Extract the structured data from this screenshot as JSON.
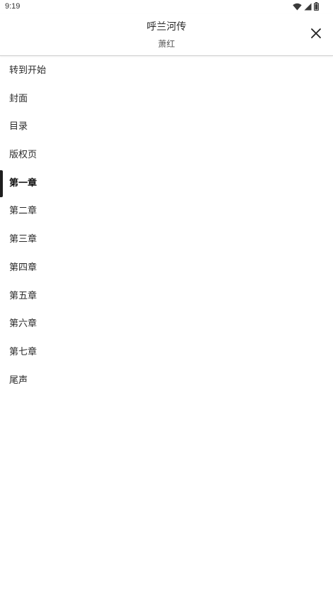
{
  "status_bar": {
    "time": "9:19",
    "icons": [
      "wifi-icon",
      "cellular-signal-icon",
      "battery-icon"
    ]
  },
  "header": {
    "title": "呼兰河传",
    "author": "萧红",
    "close_icon": "close-icon"
  },
  "toc": {
    "active_index": 4,
    "accent_color": "#1e1e1e",
    "items": [
      {
        "label": "转到开始"
      },
      {
        "label": "封面"
      },
      {
        "label": "目录"
      },
      {
        "label": "版权页"
      },
      {
        "label": "第一章"
      },
      {
        "label": "第二章"
      },
      {
        "label": "第三章"
      },
      {
        "label": "第四章"
      },
      {
        "label": "第五章"
      },
      {
        "label": "第六章"
      },
      {
        "label": "第七章"
      },
      {
        "label": "尾声"
      }
    ]
  }
}
